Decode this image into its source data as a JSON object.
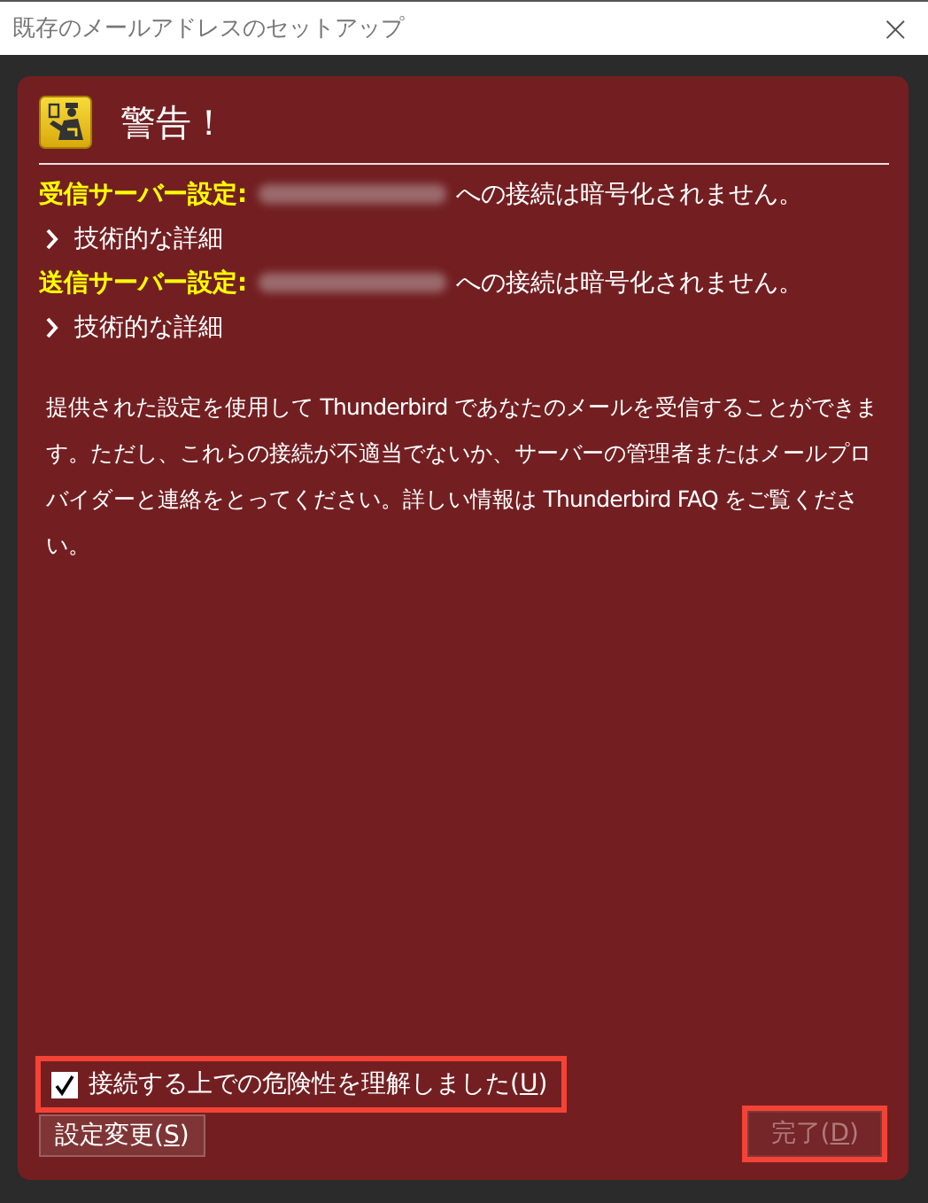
{
  "window": {
    "title": "既存のメールアドレスのセットアップ",
    "close": "×"
  },
  "warning": {
    "title": "警告！",
    "servers": [
      {
        "label": "受信サーバー設定:",
        "message": "への接続は暗号化されません。",
        "details": {
          "label": "技術的な詳細",
          "expanded": false
        }
      },
      {
        "label": "送信サーバー設定:",
        "message": "への接続は暗号化されません。",
        "details": {
          "label": "技術的な詳細",
          "expanded": false
        }
      }
    ],
    "description": "提供された設定を使用して Thunderbird であなたのメールを受信することができます。ただし、これらの接続が不適当でないか、サーバーの管理者またはメールプロバイダーと連絡をとってください。詳しい情報は Thunderbird FAQ をご覧ください。",
    "acknowledge": {
      "label_before": "接続する上での危険性を理解しました(",
      "access_key": "U",
      "label_after": ")",
      "checked": true,
      "highlighted": true
    }
  },
  "buttons": [
    {
      "label_before": "設定変更(",
      "access_key": "S",
      "label_after": ")",
      "disabled": false,
      "highlighted": false
    },
    {
      "label_before": "完了(",
      "access_key": "D",
      "label_after": ")",
      "disabled": true,
      "highlighted": true
    }
  ]
}
